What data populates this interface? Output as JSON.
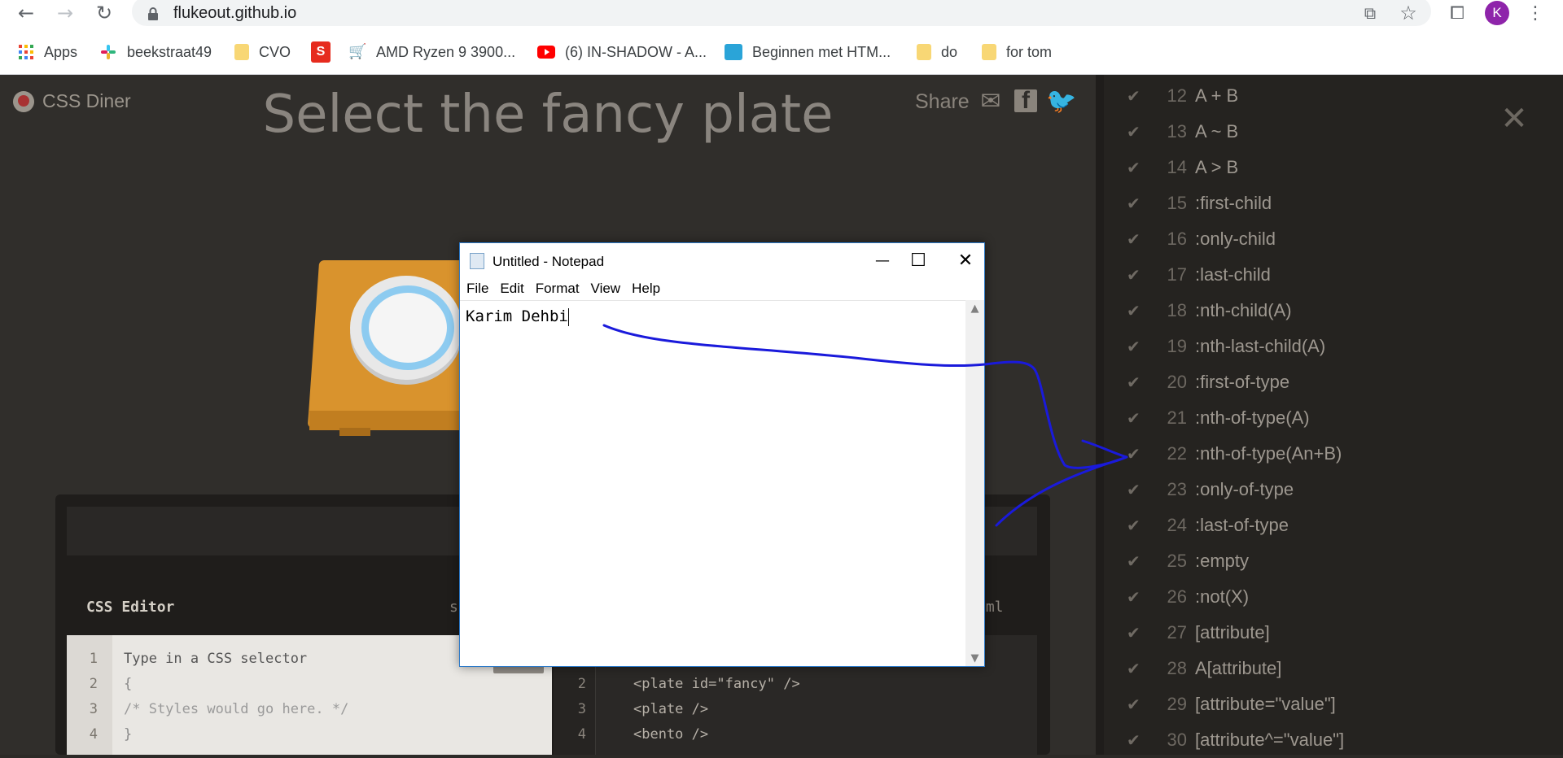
{
  "browser": {
    "url": "flukeout.github.io",
    "avatar_letter": "K",
    "bookmarks": [
      {
        "label": "Apps",
        "icon": "apps-grid-icon"
      },
      {
        "label": "beekstraat49",
        "icon": "slack-icon"
      },
      {
        "label": "CVO",
        "icon": "folder-icon"
      },
      {
        "label": "",
        "icon": "s-red-icon"
      },
      {
        "label": "AMD Ryzen 9 3900...",
        "icon": "cart-icon"
      },
      {
        "label": "(6) IN-SHADOW - A...",
        "icon": "youtube-icon"
      },
      {
        "label": "Beginnen met HTM...",
        "icon": "bird-icon"
      },
      {
        "label": "do",
        "icon": "folder-icon"
      },
      {
        "label": "for tom",
        "icon": "folder-icon"
      }
    ]
  },
  "game": {
    "logo": "CSS Diner",
    "share": "Share",
    "heading": "Select the fancy plate",
    "css_editor_title": "CSS Editor",
    "css_editor_fragment": "s",
    "html_editor_fragment": "tml",
    "css_lines": [
      {
        "n": "1",
        "code": "Type in a CSS selector"
      },
      {
        "n": "2",
        "code": "{"
      },
      {
        "n": "3",
        "code": "/* Styles would go here. */"
      },
      {
        "n": "4",
        "code": "}"
      }
    ],
    "html_lines": [
      {
        "n": "2",
        "code": "<plate id=\"fancy\" />"
      },
      {
        "n": "3",
        "code": "<plate />"
      },
      {
        "n": "4",
        "code": "<bento />"
      }
    ]
  },
  "levels": [
    {
      "n": "12",
      "label": "A + B"
    },
    {
      "n": "13",
      "label": "A ~ B"
    },
    {
      "n": "14",
      "label": "A > B"
    },
    {
      "n": "15",
      "label": ":first-child"
    },
    {
      "n": "16",
      "label": ":only-child"
    },
    {
      "n": "17",
      "label": ":last-child"
    },
    {
      "n": "18",
      "label": ":nth-child(A)"
    },
    {
      "n": "19",
      "label": ":nth-last-child(A)"
    },
    {
      "n": "20",
      "label": ":first-of-type"
    },
    {
      "n": "21",
      "label": ":nth-of-type(A)"
    },
    {
      "n": "22",
      "label": ":nth-of-type(An+B)"
    },
    {
      "n": "23",
      "label": ":only-of-type"
    },
    {
      "n": "24",
      "label": ":last-of-type"
    },
    {
      "n": "25",
      "label": ":empty"
    },
    {
      "n": "26",
      "label": ":not(X)"
    },
    {
      "n": "27",
      "label": "[attribute]"
    },
    {
      "n": "28",
      "label": "A[attribute]"
    },
    {
      "n": "29",
      "label": "[attribute=\"value\"]"
    },
    {
      "n": "30",
      "label": "[attribute^=\"value\"]"
    }
  ],
  "notepad": {
    "title": "Untitled - Notepad",
    "menu": [
      "File",
      "Edit",
      "Format",
      "View",
      "Help"
    ],
    "text": "Karim Dehbi"
  },
  "colors": {
    "annotation": "#1a1adb",
    "game_bg": "#302e2b",
    "sidebar_bg": "#252320",
    "notepad_border": "#2c79c8"
  }
}
